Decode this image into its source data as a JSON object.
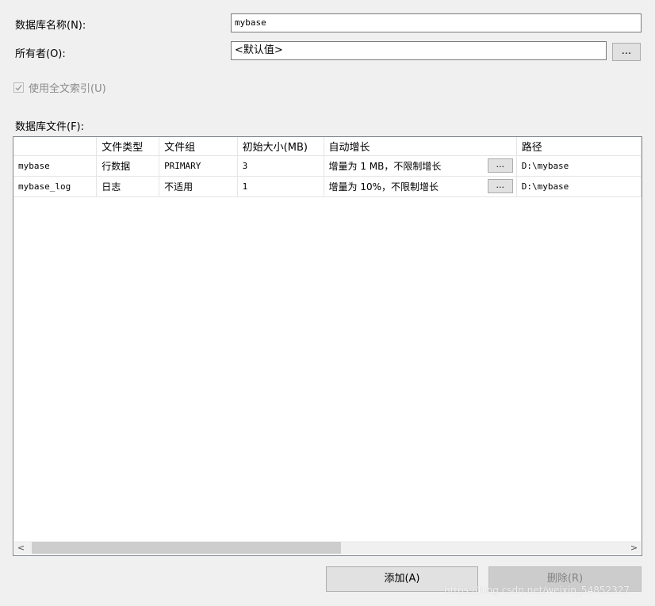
{
  "form": {
    "db_name_label": "数据库名称(N):",
    "db_name_value": "mybase",
    "owner_label": "所有者(O):",
    "owner_value": "<默认值>",
    "owner_browse": "...",
    "fulltext_label": "使用全文索引(U)",
    "fulltext_checked": true,
    "files_label": "数据库文件(F):"
  },
  "grid": {
    "columns": [
      "",
      "文件类型",
      "文件组",
      "初始大小(MB)",
      "自动增长",
      "路径"
    ],
    "rows": [
      {
        "name": "mybase",
        "type": "行数据",
        "filegroup": "PRIMARY",
        "size": "3",
        "autogrowth": "增量为 1 MB，不限制增长",
        "browse": "...",
        "path": "D:\\mybase"
      },
      {
        "name": "mybase_log",
        "type": "日志",
        "filegroup": "不适用",
        "size": "1",
        "autogrowth": "增量为 10%，不限制增长",
        "browse": "...",
        "path": "D:\\mybase"
      }
    ],
    "scroll_left": "<",
    "scroll_right": ">"
  },
  "buttons": {
    "add": "添加(A)",
    "remove": "删除(R)"
  },
  "watermark": "https://blog.csdn.net/weixin_54852327"
}
